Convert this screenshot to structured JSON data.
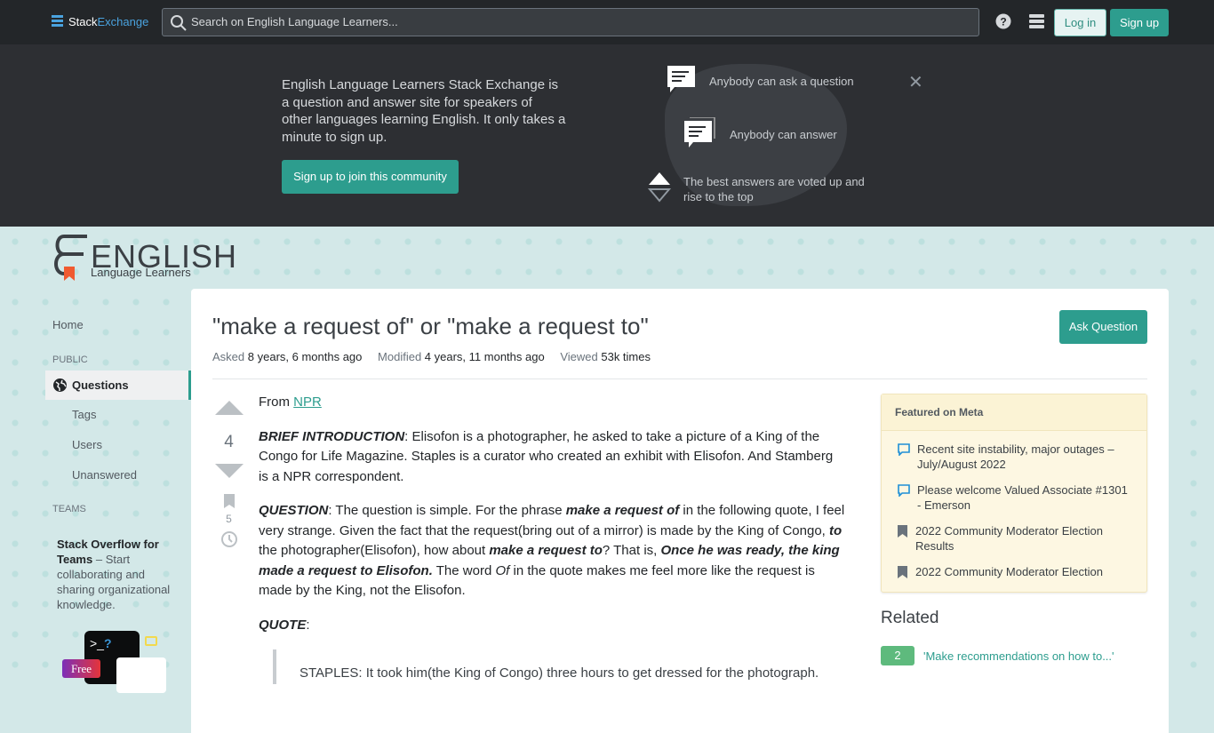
{
  "topbar": {
    "logo_a": "Stack",
    "logo_b": "Exchange",
    "search_placeholder": "Search on English Language Learners...",
    "login": "Log in",
    "signup": "Sign up"
  },
  "banner": {
    "text": "English Language Learners Stack Exchange is a question and answer site for speakers of other languages learning English. It only takes a minute to sign up.",
    "join": "Sign up to join this community",
    "features": [
      "Anybody can ask a question",
      "Anybody can answer",
      "The best answers are voted up and rise to the top"
    ]
  },
  "site": {
    "logo_big": "ENGLISH",
    "logo_small": "Language Learners"
  },
  "nav": {
    "home": "Home",
    "public": "PUBLIC",
    "questions": "Questions",
    "tags": "Tags",
    "users": "Users",
    "unanswered": "Unanswered",
    "teams": "TEAMS",
    "teams_title": "Stack Overflow for Teams",
    "teams_text": " – Start collaborating and sharing organizational knowledge.",
    "free": "Free"
  },
  "question": {
    "title": "\"make a request of\" or \"make a request to\"",
    "ask_button": "Ask Question",
    "asked_label": "Asked",
    "asked": "8 years, 6 months ago",
    "modified_label": "Modified",
    "modified": "4 years, 11 months ago",
    "viewed_label": "Viewed",
    "viewed": "53k times",
    "score": "4",
    "bookmarks": "5",
    "paragraphs": [
      [
        {
          "t": "From "
        },
        {
          "t": "NPR",
          "s": "link"
        }
      ],
      [
        {
          "t": "BRIEF INTRODUCTION",
          "s": "bi"
        },
        {
          "t": ": Elisofon is a photographer, he asked to take a picture of a King of the Congo for Life Magazine. Staples is a curator who created an exhibit with Elisofon. And Stamberg is a NPR correspondent."
        }
      ],
      [
        {
          "t": "QUESTION",
          "s": "bi"
        },
        {
          "t": ": The question is simple. For the phrase "
        },
        {
          "t": "make a request of",
          "s": "bi"
        },
        {
          "t": " in the following quote, I feel very strange. Given the fact that the request(bring out of a mirror) is made by the King of Congo, "
        },
        {
          "t": "to",
          "s": "bi"
        },
        {
          "t": " the photographer(Elisofon), how about "
        },
        {
          "t": "make a request to",
          "s": "bi"
        },
        {
          "t": "? That is, "
        },
        {
          "t": "Once he was ready, the king made a request to Elisofon.",
          "s": "bi"
        },
        {
          "t": " The word "
        },
        {
          "t": "Of",
          "s": "i"
        },
        {
          "t": " in the quote makes me feel more like the request is made by the King, not the Elisofon."
        }
      ],
      [
        {
          "t": "QUOTE",
          "s": "bi"
        },
        {
          "t": ":"
        }
      ]
    ],
    "quote": "STAPLES: It took him(the King of Congo) three hours to get dressed for the photograph."
  },
  "featured": {
    "title": "Featured on Meta",
    "items": [
      {
        "icon": "speech-bubble",
        "text": "Recent site instability, major outages – July/August 2022"
      },
      {
        "icon": "speech-bubble",
        "text": "Please welcome Valued Associate #1301 - Emerson"
      },
      {
        "icon": "bookmark",
        "text": "2022 Community Moderator Election Results"
      },
      {
        "icon": "bookmark",
        "text": "2022 Community Moderator Election"
      }
    ]
  },
  "related": {
    "title": "Related",
    "items": [
      {
        "score": "2",
        "text": "'Make recommendations on how to...'"
      }
    ]
  },
  "colors": {
    "accent": "#2d9d8e",
    "topbar": "#232629",
    "banner": "#2d2f33"
  }
}
